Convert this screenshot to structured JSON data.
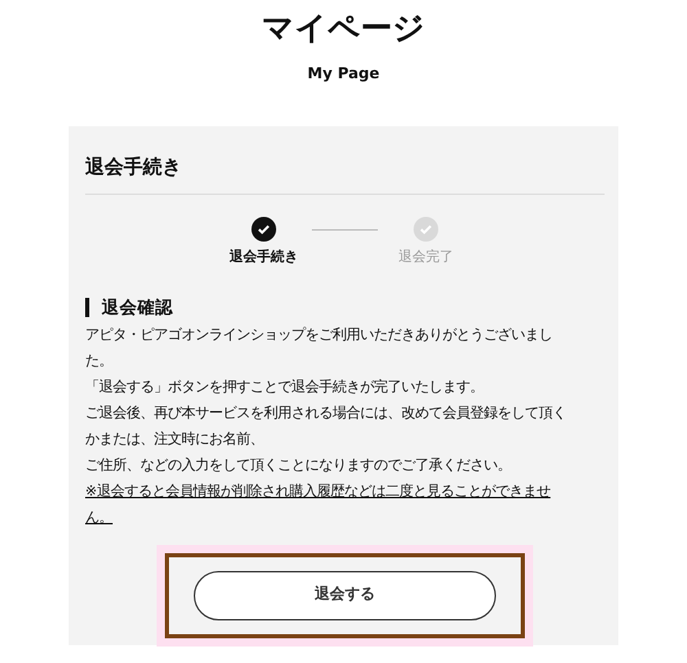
{
  "page_title": "マイページ",
  "page_subtitle": "My Page",
  "panel": {
    "heading": "退会手続き",
    "steps": [
      {
        "label": "退会手続き",
        "completed": true
      },
      {
        "label": "退会完了",
        "completed": false
      }
    ],
    "section_heading": "退会確認",
    "lines": [
      {
        "text": "アピタ・ピアゴオンラインショップをご利用いただきありがとうございまし",
        "underlined": false
      },
      {
        "text": "た。",
        "underlined": false
      },
      {
        "text": "「退会する」ボタンを押すことで退会手続きが完了いたします。",
        "underlined": false
      },
      {
        "text": "ご退会後、再び本サービスを利用される場合には、改めて会員登録をして頂く",
        "underlined": false
      },
      {
        "text": "かまたは、注文時にお名前、",
        "underlined": false
      },
      {
        "text": "ご住所、などの入力をして頂くことになりますのでご了承ください。",
        "underlined": false
      },
      {
        "text": "※退会すると会員情報が削除され購入履歴などは二度と見ることができませ",
        "underlined": true
      },
      {
        "text": "ん。",
        "underlined": true
      }
    ],
    "button": {
      "label": "退会する",
      "highlighted": true
    }
  }
}
